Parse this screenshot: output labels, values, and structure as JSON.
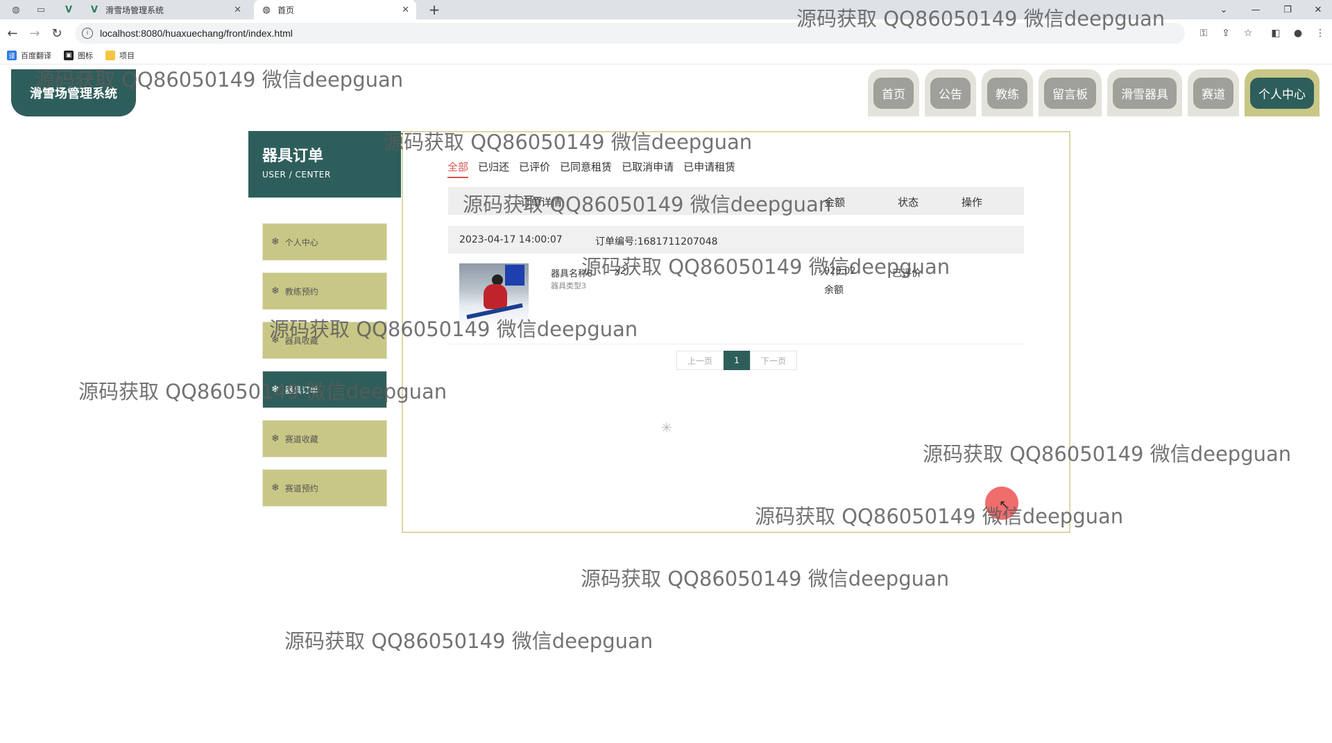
{
  "browser": {
    "tabs": [
      {
        "title": "滑雪场管理系统",
        "icon": "vue-logo-icon"
      },
      {
        "title": "首页",
        "icon": "globe-icon"
      }
    ],
    "url": "localhost:8080/huaxuechang/front/index.html",
    "bookmarks": [
      "百度翻译",
      "图标",
      "项目"
    ]
  },
  "site": {
    "logo": "滑雪场管理系统",
    "nav": [
      "首页",
      "公告",
      "教练",
      "留言板",
      "滑雪器具",
      "赛道",
      "个人中心"
    ],
    "active_nav": "个人中心"
  },
  "sidebar": {
    "title": "器具订单",
    "subtitle": "USER / CENTER",
    "items": [
      "个人中心",
      "教练预约",
      "器具收藏",
      "器具订单",
      "赛道收藏",
      "赛道预约"
    ],
    "active_item": "器具订单"
  },
  "orders": {
    "filter_tabs": [
      "全部",
      "已归还",
      "已评价",
      "已同意租赁",
      "已取消申请",
      "已申请租赁"
    ],
    "active_tab": "全部",
    "columns": [
      "订单详情",
      "金额",
      "状态",
      "操作"
    ],
    "list": [
      {
        "date": "2023-04-17 14:00:07",
        "order_no": "订单编号:1681711207048",
        "product_name": "器具名称6",
        "product_type": "器具类型3",
        "quantity": "x2",
        "amount": "929.02",
        "pay_method": "余额",
        "status": "已评价"
      }
    ]
  },
  "pagination": {
    "prev": "上一页",
    "current": "1",
    "next": "下一页"
  },
  "watermark": "源码获取 QQ86050149 微信deepguan",
  "colors": {
    "brand": "#2e5e5b",
    "accent_olive": "#c9c786",
    "active_tab_red": "#d9534f"
  }
}
